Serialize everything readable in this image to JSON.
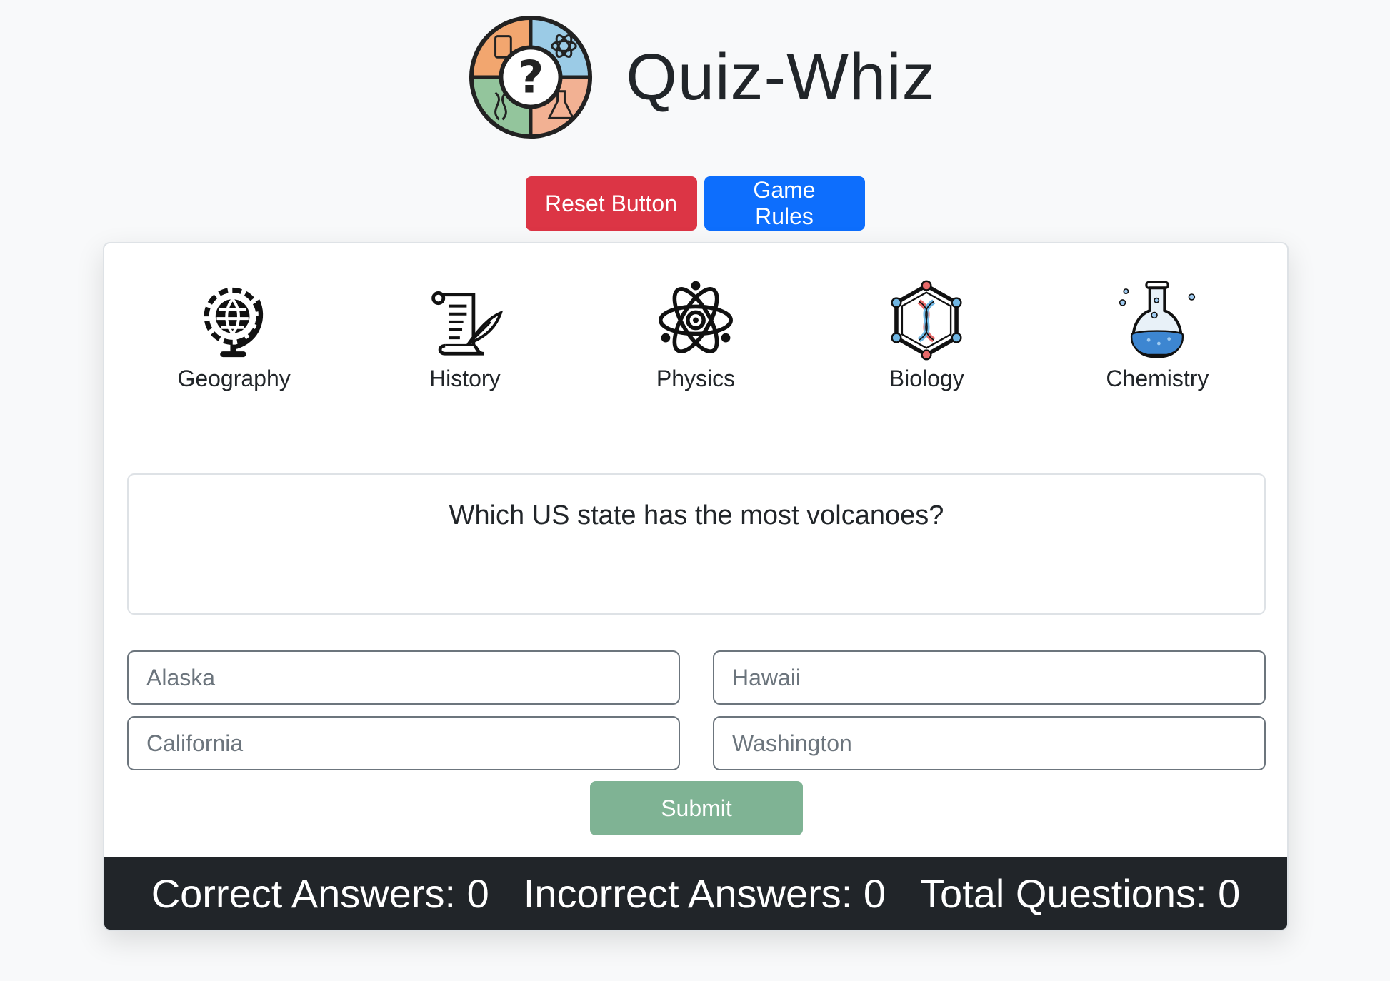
{
  "app": {
    "title": "Quiz-Whiz"
  },
  "buttons": {
    "reset": "Reset Button",
    "rules": "Game Rules",
    "submit": "Submit"
  },
  "categories": [
    {
      "label": "Geography",
      "icon": "globe-icon"
    },
    {
      "label": "History",
      "icon": "scroll-quill-icon"
    },
    {
      "label": "Physics",
      "icon": "atom-icon"
    },
    {
      "label": "Biology",
      "icon": "dna-icon"
    },
    {
      "label": "Chemistry",
      "icon": "flask-icon"
    }
  ],
  "question": {
    "text": "Which US state has the most volcanoes?"
  },
  "answers": [
    {
      "placeholder": "Alaska"
    },
    {
      "placeholder": "Hawaii"
    },
    {
      "placeholder": "California"
    },
    {
      "placeholder": "Washington"
    }
  ],
  "score": {
    "correct": "Correct Answers: 0",
    "incorrect": "Incorrect Answers: 0",
    "total": "Total Questions: 0"
  },
  "colors": {
    "reset": "#dc3545",
    "rules": "#0d6efd",
    "submit": "#7fb394",
    "scorebar": "#212529"
  }
}
